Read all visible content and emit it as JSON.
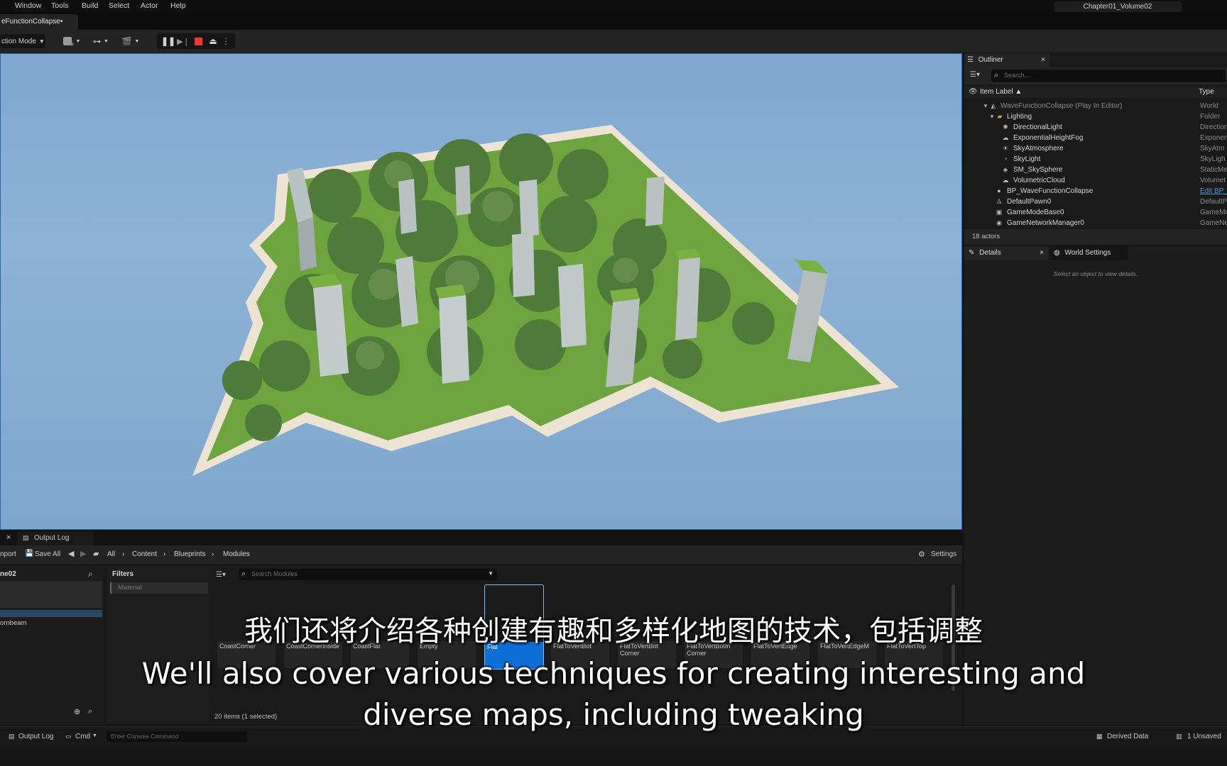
{
  "menu": [
    "Window",
    "Tools",
    "Build",
    "Select",
    "Actor",
    "Help"
  ],
  "level_name": "Chapter01_Volume02",
  "document_tab": "eFunctionCollapse•",
  "toolbar": {
    "mode_label": "ction Mode"
  },
  "outliner": {
    "tab_label": "Outliner",
    "search_placeholder": "Search...",
    "col_label": "Item Label ▲",
    "col_type": "Type",
    "rows": [
      {
        "label": "WaveFunctionCollapse (Play In Editor)",
        "type": "World"
      },
      {
        "label": "Lighting",
        "type": "Folder"
      },
      {
        "label": "DirectionalLight",
        "type": "Direction"
      },
      {
        "label": "ExponentialHeightFog",
        "type": "Exponen"
      },
      {
        "label": "SkyAtmosphere",
        "type": "SkyAtm"
      },
      {
        "label": "SkyLight",
        "type": "SkyLigh"
      },
      {
        "label": "SM_SkySphere",
        "type": "StaticMe"
      },
      {
        "label": "VolumetricCloud",
        "type": "Volumet"
      },
      {
        "label": "BP_WaveFunctionCollapse",
        "type": "Edit BP_"
      },
      {
        "label": "DefaultPawn0",
        "type": "DefaultP"
      },
      {
        "label": "GameModeBase0",
        "type": "GameMo"
      },
      {
        "label": "GameNetworkManager0",
        "type": "GameNe"
      }
    ],
    "actor_count": "18 actors"
  },
  "details": {
    "tab_label": "Details",
    "world_settings_label": "World Settings",
    "empty_hint": "Select an object to view details."
  },
  "content_browser": {
    "output_log_tab": "Output Log",
    "import_label": "nport",
    "save_all": "Save All",
    "breadcrumb": [
      "All",
      "Content",
      "Blueprints",
      "Modules"
    ],
    "settings_label": "Settings",
    "sources_header": "ne02",
    "sources_item": "ornbeam",
    "filters_label": "Filters",
    "filter_chip": "Material",
    "search_placeholder": "Search Modules",
    "assets": [
      "CoastCorner",
      "CoastCornerInside",
      "CoastFlat",
      "Empty",
      "Flat",
      "FlatToVertBot",
      "FlatToVertBot\nCorner",
      "FlatToVertBotIn\nCorner",
      "FlatToVertEdge",
      "FlatToVertEdgeM",
      "FlatToVertTop"
    ],
    "item_count": "20 items (1 selected)"
  },
  "statusbar": {
    "output_log": "Output Log",
    "cmd": "Cmd",
    "console_placeholder": "Enter Console Command",
    "derived_data": "Derived Data",
    "unsaved": "1 Unsaved"
  },
  "subtitles": {
    "zh": "我们还将介绍各种创建有趣和多样化地图的技术，包括调整",
    "en_line1": "We'll also cover various techniques for creating interesting and",
    "en_line2": "diverse maps, including tweaking"
  }
}
